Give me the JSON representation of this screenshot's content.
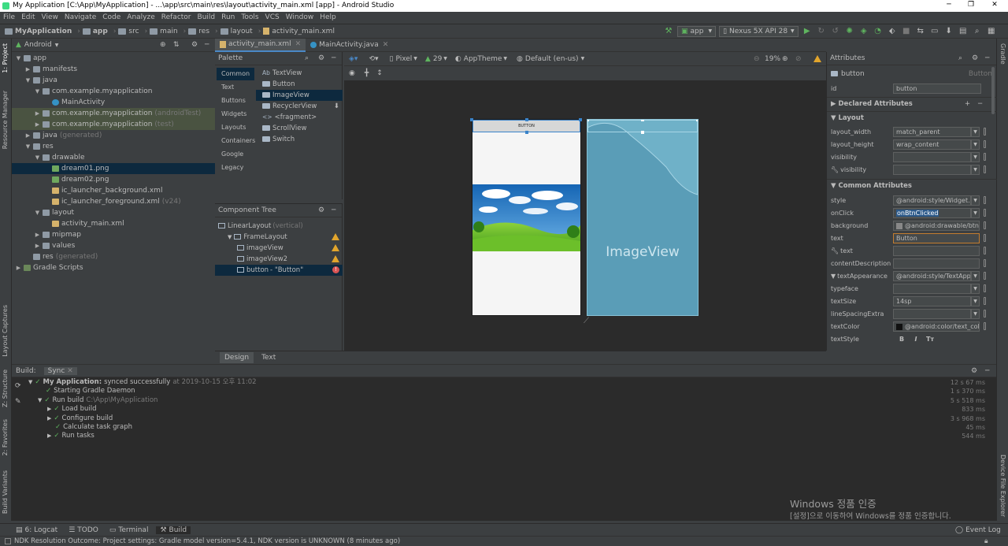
{
  "window": {
    "title": "My Application [C:\\App\\MyApplication] - ...\\app\\src\\main\\res\\layout\\activity_main.xml [app] - Android Studio",
    "minimize": "─",
    "maximize": "❐",
    "close": "✕"
  },
  "menu": [
    "File",
    "Edit",
    "View",
    "Navigate",
    "Code",
    "Analyze",
    "Refactor",
    "Build",
    "Run",
    "Tools",
    "VCS",
    "Window",
    "Help"
  ],
  "breadcrumb": [
    "MyApplication",
    "app",
    "src",
    "main",
    "res",
    "layout",
    "activity_main.xml"
  ],
  "toolbar": {
    "run_config": "app",
    "device": "Nexus 5X API 28"
  },
  "project": {
    "view_label": "Android",
    "items": [
      {
        "label": "app",
        "indent": 0,
        "arrow": "▼",
        "icon": "folder"
      },
      {
        "label": "manifests",
        "indent": 1,
        "arrow": "▶",
        "icon": "folder"
      },
      {
        "label": "java",
        "indent": 1,
        "arrow": "▼",
        "icon": "folder"
      },
      {
        "label": "com.example.myapplication",
        "indent": 2,
        "arrow": "▼",
        "icon": "folder"
      },
      {
        "label": "MainActivity",
        "indent": 3,
        "arrow": "",
        "icon": "class"
      },
      {
        "label": "com.example.myapplication",
        "suffix": "(androidTest)",
        "indent": 2,
        "arrow": "▶",
        "icon": "folder"
      },
      {
        "label": "com.example.myapplication",
        "suffix": "(test)",
        "indent": 2,
        "arrow": "▶",
        "icon": "folder"
      },
      {
        "label": "java",
        "suffix": "(generated)",
        "indent": 1,
        "arrow": "▶",
        "icon": "folder"
      },
      {
        "label": "res",
        "indent": 1,
        "arrow": "▼",
        "icon": "folder"
      },
      {
        "label": "drawable",
        "indent": 2,
        "arrow": "▼",
        "icon": "folder"
      },
      {
        "label": "dream01.png",
        "indent": 3,
        "arrow": "",
        "icon": "image"
      },
      {
        "label": "dream02.png",
        "indent": 3,
        "arrow": "",
        "icon": "image"
      },
      {
        "label": "ic_launcher_background.xml",
        "indent": 3,
        "arrow": "",
        "icon": "xml"
      },
      {
        "label": "ic_launcher_foreground.xml",
        "suffix": "(v24)",
        "indent": 3,
        "arrow": "",
        "icon": "xml"
      },
      {
        "label": "layout",
        "indent": 2,
        "arrow": "▼",
        "icon": "folder"
      },
      {
        "label": "activity_main.xml",
        "indent": 3,
        "arrow": "",
        "icon": "xml"
      },
      {
        "label": "mipmap",
        "indent": 2,
        "arrow": "▶",
        "icon": "folder"
      },
      {
        "label": "values",
        "indent": 2,
        "arrow": "▶",
        "icon": "folder"
      },
      {
        "label": "res",
        "suffix": "(generated)",
        "indent": 1,
        "arrow": "",
        "icon": "folder"
      },
      {
        "label": "Gradle Scripts",
        "indent": 0,
        "arrow": "▶",
        "icon": "gradle"
      }
    ]
  },
  "left_strip": [
    "1: Project",
    "Resource Manager",
    "Layout Captures",
    "Z: Structure",
    "2: Favorites",
    "Build Variants"
  ],
  "right_strip": [
    "Gradle",
    "Device File Explorer"
  ],
  "editor_tabs": [
    {
      "label": "activity_main.xml",
      "active": true
    },
    {
      "label": "MainActivity.java",
      "active": false
    }
  ],
  "palette": {
    "title": "Palette",
    "categories": [
      "Common",
      "Text",
      "Buttons",
      "Widgets",
      "Layouts",
      "Containers",
      "Google",
      "Legacy"
    ],
    "items": [
      {
        "prefix": "Ab",
        "label": "TextView"
      },
      {
        "prefix": "",
        "label": "Button"
      },
      {
        "prefix": "",
        "label": "ImageView"
      },
      {
        "prefix": "",
        "label": "RecyclerView"
      },
      {
        "prefix": "<>",
        "label": "<fragment>"
      },
      {
        "prefix": "",
        "label": "ScrollView"
      },
      {
        "prefix": "",
        "label": "Switch"
      }
    ]
  },
  "component_tree": {
    "title": "Component Tree",
    "items": [
      {
        "label": "LinearLayout",
        "suffix": "(vertical)",
        "indent": 0,
        "status": ""
      },
      {
        "label": "FrameLayout",
        "suffix": "",
        "indent": 1,
        "status": "warn"
      },
      {
        "label": "imageView",
        "suffix": "",
        "indent": 2,
        "status": "warn"
      },
      {
        "label": "imageView2",
        "suffix": "",
        "indent": 2,
        "status": "warn"
      },
      {
        "label": "button",
        "suffix": "- \"Button\"",
        "indent": 2,
        "status": "error"
      }
    ]
  },
  "design_toolbar": {
    "device": "Pixel",
    "api": "29",
    "theme": "AppTheme",
    "locale": "Default (en-us)",
    "zoom": "19%"
  },
  "canvas": {
    "button_text": "BUTTON",
    "blueprint_label": "ImageView"
  },
  "attributes": {
    "title": "Attributes",
    "widget": "button",
    "widget_type": "Button",
    "id_label": "id",
    "id_value": "button",
    "sections": {
      "declared": "Declared Attributes",
      "layout": "Layout",
      "common": "Common Attributes"
    },
    "layout_rows": [
      {
        "label": "layout_width",
        "value": "match_parent",
        "dropdown": true
      },
      {
        "label": "layout_height",
        "value": "wrap_content",
        "dropdown": true
      },
      {
        "label": "visibility",
        "value": "",
        "dropdown": true
      },
      {
        "label": "visibility",
        "value": "",
        "dropdown": true,
        "wrench": true
      }
    ],
    "common_rows": [
      {
        "label": "style",
        "value": "@android:style/Widget.I",
        "dropdown": true
      },
      {
        "label": "onClick",
        "value": "onBtnClicked",
        "dropdown": true,
        "selected": true
      },
      {
        "label": "background",
        "value": "@android:drawable/btn_de",
        "dropdown": false
      },
      {
        "label": "text",
        "value": "Button",
        "dropdown": false,
        "focused": true
      },
      {
        "label": "text",
        "value": "",
        "dropdown": false,
        "wrench": true
      },
      {
        "label": "contentDescription",
        "value": "",
        "dropdown": false
      },
      {
        "label": "textAppearance",
        "value": "@android:style/TextApp",
        "dropdown": true,
        "expanded": true
      },
      {
        "label": "typeface",
        "value": "",
        "dropdown": true
      },
      {
        "label": "textSize",
        "value": "14sp",
        "dropdown": true
      },
      {
        "label": "lineSpacingExtra",
        "value": "",
        "dropdown": true
      },
      {
        "label": "textColor",
        "value": "@android:color/text_color",
        "dropdown": false
      },
      {
        "label": "textStyle",
        "value": "",
        "dropdown": false
      }
    ],
    "text_style_buttons": [
      "B",
      "I",
      "Tт"
    ]
  },
  "design_text_tabs": [
    "Design",
    "Text"
  ],
  "build": {
    "title": "Build:",
    "tab": "Sync",
    "lines": [
      {
        "label": "My Application:",
        "rest": "synced successfully",
        "meta": "at 2019-10-15 오후 11:02",
        "indent": 0,
        "time": "12 s 67 ms",
        "arrow": "▼",
        "bold": true
      },
      {
        "label": "Starting Gradle Daemon",
        "rest": "",
        "meta": "",
        "indent": 1,
        "time": "1 s 370 ms",
        "arrow": "",
        "bold": false
      },
      {
        "label": "Run build",
        "rest": "",
        "meta": "C:\\App\\MyApplication",
        "indent": 1,
        "time": "5 s 518 ms",
        "arrow": "▼",
        "bold": false
      },
      {
        "label": "Load build",
        "rest": "",
        "meta": "",
        "indent": 2,
        "time": "833 ms",
        "arrow": "▶",
        "bold": false
      },
      {
        "label": "Configure build",
        "rest": "",
        "meta": "",
        "indent": 2,
        "time": "3 s 968 ms",
        "arrow": "▶",
        "bold": false
      },
      {
        "label": "Calculate task graph",
        "rest": "",
        "meta": "",
        "indent": 2,
        "time": "45 ms",
        "arrow": "",
        "bold": false
      },
      {
        "label": "Run tasks",
        "rest": "",
        "meta": "",
        "indent": 2,
        "time": "544 ms",
        "arrow": "▶",
        "bold": false
      }
    ]
  },
  "watermark": {
    "line1": "Windows 정품 인증",
    "line2": "[설정]으로 이동하여 Windows를 정품 인증합니다."
  },
  "bottom_tabs": [
    "6: Logcat",
    "TODO",
    "Terminal",
    "Build"
  ],
  "event_log": "Event Log",
  "status": "NDK Resolution Outcome: Project settings: Gradle model version=5.4.1, NDK version is UNKNOWN (8 minutes ago)",
  "colors": {
    "accent": "#4a88c7",
    "success": "#5fb55f",
    "warning": "#e2a52c",
    "error": "#d75353",
    "blueprint": "#5a9db7"
  }
}
